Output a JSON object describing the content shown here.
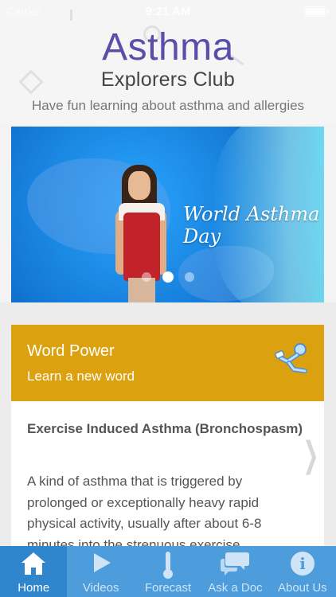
{
  "status": {
    "carrier": "Carrier",
    "time": "9:21 AM"
  },
  "header": {
    "title": "Asthma",
    "subtitle": "Explorers Club",
    "tagline": "Have fun learning about asthma and allergies"
  },
  "banner": {
    "headline": "World Asthma Day",
    "page_count": 3,
    "active_index": 1
  },
  "word_power": {
    "title": "Word Power",
    "subtitle": "Learn a new word",
    "icon": "inhaler-icon",
    "term": "Exercise Induced Asthma (Bronchospasm)",
    "definition": "A kind of asthma that is triggered by prolonged or exceptionally heavy rapid physical activity, usually after about 6-8 minutes into the strenuous exercise"
  },
  "tabs": [
    {
      "label": "Home",
      "icon": "home-icon",
      "active": true
    },
    {
      "label": "Videos",
      "icon": "play-icon",
      "active": false
    },
    {
      "label": "Forecast",
      "icon": "thermometer-icon",
      "active": false
    },
    {
      "label": "Ask a Doc",
      "icon": "chat-bubbles-icon",
      "active": false
    },
    {
      "label": "About Us",
      "icon": "info-icon",
      "active": false
    }
  ],
  "colors": {
    "title": "#5a4fa8",
    "card_header": "#dba10f",
    "tabbar": "#4d9cdb",
    "tab_active": "#2f86cd"
  }
}
